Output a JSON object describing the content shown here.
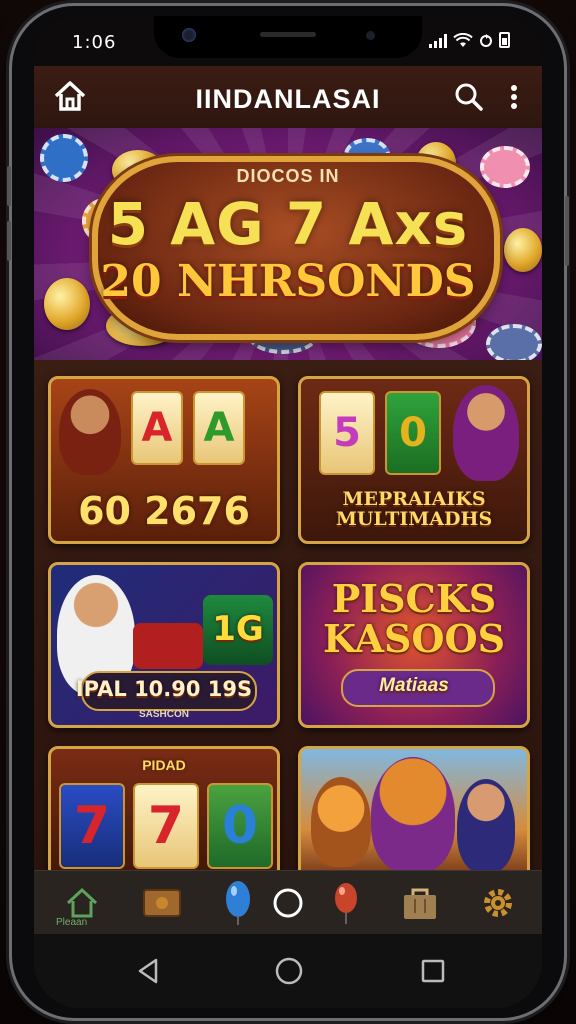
{
  "status_bar": {
    "time": "1:06"
  },
  "app_bar": {
    "title": "IINDANLASAI"
  },
  "banner": {
    "line1": "DIOCOS IN",
    "line2": "5 AG 7 Axs",
    "line3": "20 NHRSONDS"
  },
  "games": [
    {
      "name": "60 2676",
      "reels": [
        "A",
        "A"
      ]
    },
    {
      "name": "MEPRAIAIKS MULTIMADHS",
      "reels": [
        "5",
        "0"
      ]
    },
    {
      "name": "IPAL 10.90 19S",
      "sub": "SASHCON",
      "badge": "1G"
    },
    {
      "name": "PISCKS KASOOS",
      "sub": "Matiaas"
    },
    {
      "name": "",
      "reels": [
        "7",
        "7",
        "0"
      ],
      "tag": "PIDAD"
    },
    {
      "name": ""
    }
  ],
  "bottom_nav": {
    "home_label": "Pleaan"
  },
  "colors": {
    "accent_gold": "#d6a543",
    "appbar_bg": "#3b1d14",
    "banner_purple": "#7c1e7e"
  }
}
